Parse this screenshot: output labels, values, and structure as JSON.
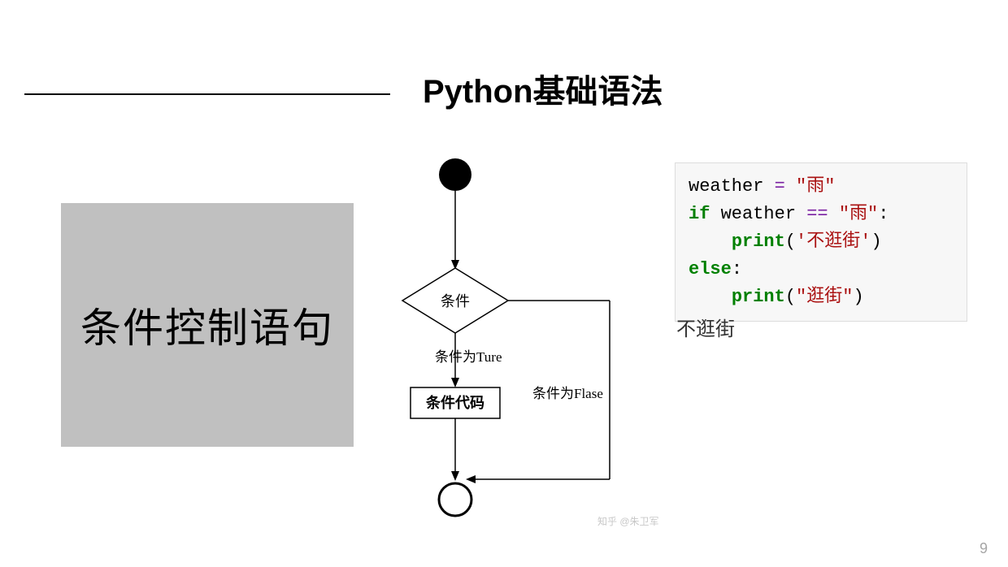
{
  "header": {
    "title": "Python基础语法"
  },
  "subtitle": "条件控制语句",
  "flowchart": {
    "condition": "条件",
    "true_label": "条件为Ture",
    "false_label": "条件为Flase",
    "code_box": "条件代码"
  },
  "code": {
    "line1_var": "weather ",
    "line1_eq": "=",
    "line1_str": " \"雨\"",
    "line2_if": "if",
    "line2_cond": " weather ",
    "line2_op": "==",
    "line2_str": " \"雨\"",
    "line2_colon": ":",
    "line3_indent": "    ",
    "line3_fn": "print",
    "line3_open": "(",
    "line3_str": "'不逛街'",
    "line3_close": ")",
    "line4_else": "else",
    "line4_colon": ":",
    "line5_indent": "    ",
    "line5_fn": "print",
    "line5_open": "(",
    "line5_str": "\"逛街\"",
    "line5_close": ")"
  },
  "output": "不逛街",
  "page_number": "9",
  "watermark": "知乎 @朱卫军"
}
